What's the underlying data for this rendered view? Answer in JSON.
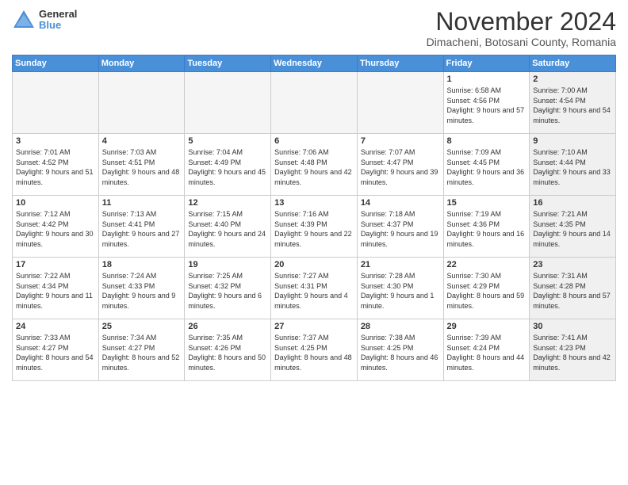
{
  "logo": {
    "general": "General",
    "blue": "Blue"
  },
  "title": "November 2024",
  "location": "Dimacheni, Botosani County, Romania",
  "days_of_week": [
    "Sunday",
    "Monday",
    "Tuesday",
    "Wednesday",
    "Thursday",
    "Friday",
    "Saturday"
  ],
  "weeks": [
    [
      {
        "day": "",
        "info": "",
        "empty": true
      },
      {
        "day": "",
        "info": "",
        "empty": true
      },
      {
        "day": "",
        "info": "",
        "empty": true
      },
      {
        "day": "",
        "info": "",
        "empty": true
      },
      {
        "day": "",
        "info": "",
        "empty": true
      },
      {
        "day": "1",
        "info": "Sunrise: 6:58 AM\nSunset: 4:56 PM\nDaylight: 9 hours and 57 minutes.",
        "empty": false,
        "shaded": false
      },
      {
        "day": "2",
        "info": "Sunrise: 7:00 AM\nSunset: 4:54 PM\nDaylight: 9 hours and 54 minutes.",
        "empty": false,
        "shaded": true
      }
    ],
    [
      {
        "day": "3",
        "info": "Sunrise: 7:01 AM\nSunset: 4:52 PM\nDaylight: 9 hours and 51 minutes.",
        "empty": false,
        "shaded": false
      },
      {
        "day": "4",
        "info": "Sunrise: 7:03 AM\nSunset: 4:51 PM\nDaylight: 9 hours and 48 minutes.",
        "empty": false,
        "shaded": false
      },
      {
        "day": "5",
        "info": "Sunrise: 7:04 AM\nSunset: 4:49 PM\nDaylight: 9 hours and 45 minutes.",
        "empty": false,
        "shaded": false
      },
      {
        "day": "6",
        "info": "Sunrise: 7:06 AM\nSunset: 4:48 PM\nDaylight: 9 hours and 42 minutes.",
        "empty": false,
        "shaded": false
      },
      {
        "day": "7",
        "info": "Sunrise: 7:07 AM\nSunset: 4:47 PM\nDaylight: 9 hours and 39 minutes.",
        "empty": false,
        "shaded": false
      },
      {
        "day": "8",
        "info": "Sunrise: 7:09 AM\nSunset: 4:45 PM\nDaylight: 9 hours and 36 minutes.",
        "empty": false,
        "shaded": false
      },
      {
        "day": "9",
        "info": "Sunrise: 7:10 AM\nSunset: 4:44 PM\nDaylight: 9 hours and 33 minutes.",
        "empty": false,
        "shaded": true
      }
    ],
    [
      {
        "day": "10",
        "info": "Sunrise: 7:12 AM\nSunset: 4:42 PM\nDaylight: 9 hours and 30 minutes.",
        "empty": false,
        "shaded": false
      },
      {
        "day": "11",
        "info": "Sunrise: 7:13 AM\nSunset: 4:41 PM\nDaylight: 9 hours and 27 minutes.",
        "empty": false,
        "shaded": false
      },
      {
        "day": "12",
        "info": "Sunrise: 7:15 AM\nSunset: 4:40 PM\nDaylight: 9 hours and 24 minutes.",
        "empty": false,
        "shaded": false
      },
      {
        "day": "13",
        "info": "Sunrise: 7:16 AM\nSunset: 4:39 PM\nDaylight: 9 hours and 22 minutes.",
        "empty": false,
        "shaded": false
      },
      {
        "day": "14",
        "info": "Sunrise: 7:18 AM\nSunset: 4:37 PM\nDaylight: 9 hours and 19 minutes.",
        "empty": false,
        "shaded": false
      },
      {
        "day": "15",
        "info": "Sunrise: 7:19 AM\nSunset: 4:36 PM\nDaylight: 9 hours and 16 minutes.",
        "empty": false,
        "shaded": false
      },
      {
        "day": "16",
        "info": "Sunrise: 7:21 AM\nSunset: 4:35 PM\nDaylight: 9 hours and 14 minutes.",
        "empty": false,
        "shaded": true
      }
    ],
    [
      {
        "day": "17",
        "info": "Sunrise: 7:22 AM\nSunset: 4:34 PM\nDaylight: 9 hours and 11 minutes.",
        "empty": false,
        "shaded": false
      },
      {
        "day": "18",
        "info": "Sunrise: 7:24 AM\nSunset: 4:33 PM\nDaylight: 9 hours and 9 minutes.",
        "empty": false,
        "shaded": false
      },
      {
        "day": "19",
        "info": "Sunrise: 7:25 AM\nSunset: 4:32 PM\nDaylight: 9 hours and 6 minutes.",
        "empty": false,
        "shaded": false
      },
      {
        "day": "20",
        "info": "Sunrise: 7:27 AM\nSunset: 4:31 PM\nDaylight: 9 hours and 4 minutes.",
        "empty": false,
        "shaded": false
      },
      {
        "day": "21",
        "info": "Sunrise: 7:28 AM\nSunset: 4:30 PM\nDaylight: 9 hours and 1 minute.",
        "empty": false,
        "shaded": false
      },
      {
        "day": "22",
        "info": "Sunrise: 7:30 AM\nSunset: 4:29 PM\nDaylight: 8 hours and 59 minutes.",
        "empty": false,
        "shaded": false
      },
      {
        "day": "23",
        "info": "Sunrise: 7:31 AM\nSunset: 4:28 PM\nDaylight: 8 hours and 57 minutes.",
        "empty": false,
        "shaded": true
      }
    ],
    [
      {
        "day": "24",
        "info": "Sunrise: 7:33 AM\nSunset: 4:27 PM\nDaylight: 8 hours and 54 minutes.",
        "empty": false,
        "shaded": false
      },
      {
        "day": "25",
        "info": "Sunrise: 7:34 AM\nSunset: 4:27 PM\nDaylight: 8 hours and 52 minutes.",
        "empty": false,
        "shaded": false
      },
      {
        "day": "26",
        "info": "Sunrise: 7:35 AM\nSunset: 4:26 PM\nDaylight: 8 hours and 50 minutes.",
        "empty": false,
        "shaded": false
      },
      {
        "day": "27",
        "info": "Sunrise: 7:37 AM\nSunset: 4:25 PM\nDaylight: 8 hours and 48 minutes.",
        "empty": false,
        "shaded": false
      },
      {
        "day": "28",
        "info": "Sunrise: 7:38 AM\nSunset: 4:25 PM\nDaylight: 8 hours and 46 minutes.",
        "empty": false,
        "shaded": false
      },
      {
        "day": "29",
        "info": "Sunrise: 7:39 AM\nSunset: 4:24 PM\nDaylight: 8 hours and 44 minutes.",
        "empty": false,
        "shaded": false
      },
      {
        "day": "30",
        "info": "Sunrise: 7:41 AM\nSunset: 4:23 PM\nDaylight: 8 hours and 42 minutes.",
        "empty": false,
        "shaded": true
      }
    ]
  ]
}
